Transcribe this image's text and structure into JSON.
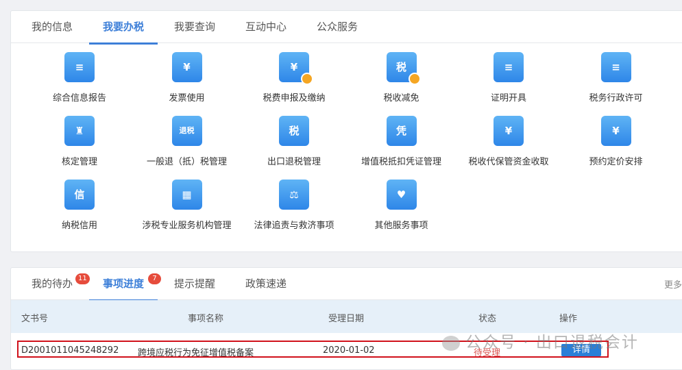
{
  "top_tabs": [
    "我的信息",
    "我要办税",
    "我要查询",
    "互动中心",
    "公众服务"
  ],
  "active_top_tab": 1,
  "services": [
    {
      "label": "综合信息报告",
      "icon": "report-icon",
      "glyph": "≡"
    },
    {
      "label": "发票使用",
      "icon": "invoice-icon",
      "glyph": "¥"
    },
    {
      "label": "税费申报及缴纳",
      "icon": "hand-coin-icon",
      "glyph": "¥"
    },
    {
      "label": "税收减免",
      "icon": "tax-reduction-icon",
      "glyph": "税"
    },
    {
      "label": "证明开具",
      "icon": "certificate-icon",
      "glyph": "≡"
    },
    {
      "label": "税务行政许可",
      "icon": "license-icon",
      "glyph": "≡"
    },
    {
      "label": "核定管理",
      "icon": "stamp-icon",
      "glyph": "♜"
    },
    {
      "label": "一般退（抵）税管理",
      "icon": "refund-icon",
      "glyph": "退税"
    },
    {
      "label": "出口退税管理",
      "icon": "export-refund-icon",
      "glyph": "税"
    },
    {
      "label": "增值税抵扣凭证管理",
      "icon": "voucher-icon",
      "glyph": "凭"
    },
    {
      "label": "税收代保管资金收取",
      "icon": "custody-fund-icon",
      "glyph": "¥"
    },
    {
      "label": "预约定价安排",
      "icon": "calendar-icon",
      "glyph": "¥"
    },
    {
      "label": "纳税信用",
      "icon": "credit-medal-icon",
      "glyph": "信"
    },
    {
      "label": "涉税专业服务机构管理",
      "icon": "agency-building-icon",
      "glyph": "▦"
    },
    {
      "label": "法律追责与救济事项",
      "icon": "gavel-icon",
      "glyph": "⚖"
    },
    {
      "label": "其他服务事项",
      "icon": "heart-hands-icon",
      "glyph": "♥"
    }
  ],
  "bottom_tabs": [
    {
      "label": "我的待办",
      "badge": "11"
    },
    {
      "label": "事项进度",
      "badge": "7"
    },
    {
      "label": "提示提醒"
    },
    {
      "label": "政策速递"
    }
  ],
  "active_bottom_tab": 1,
  "more_label": "更多",
  "table": {
    "headers": [
      "文书号",
      "事项名称",
      "受理日期",
      "状态",
      "操作"
    ],
    "rows": [
      {
        "doc_no": "D2001011045248292",
        "name": "跨境应税行为免征增值税备案",
        "date": "2020-01-02",
        "status": "待受理",
        "action": "详情"
      }
    ]
  },
  "watermark": "公众号 · 出口退税会计",
  "colors": {
    "accent": "#3d7fd8",
    "status_pending": "#d9534f",
    "highlight_box": "#d0101a"
  }
}
